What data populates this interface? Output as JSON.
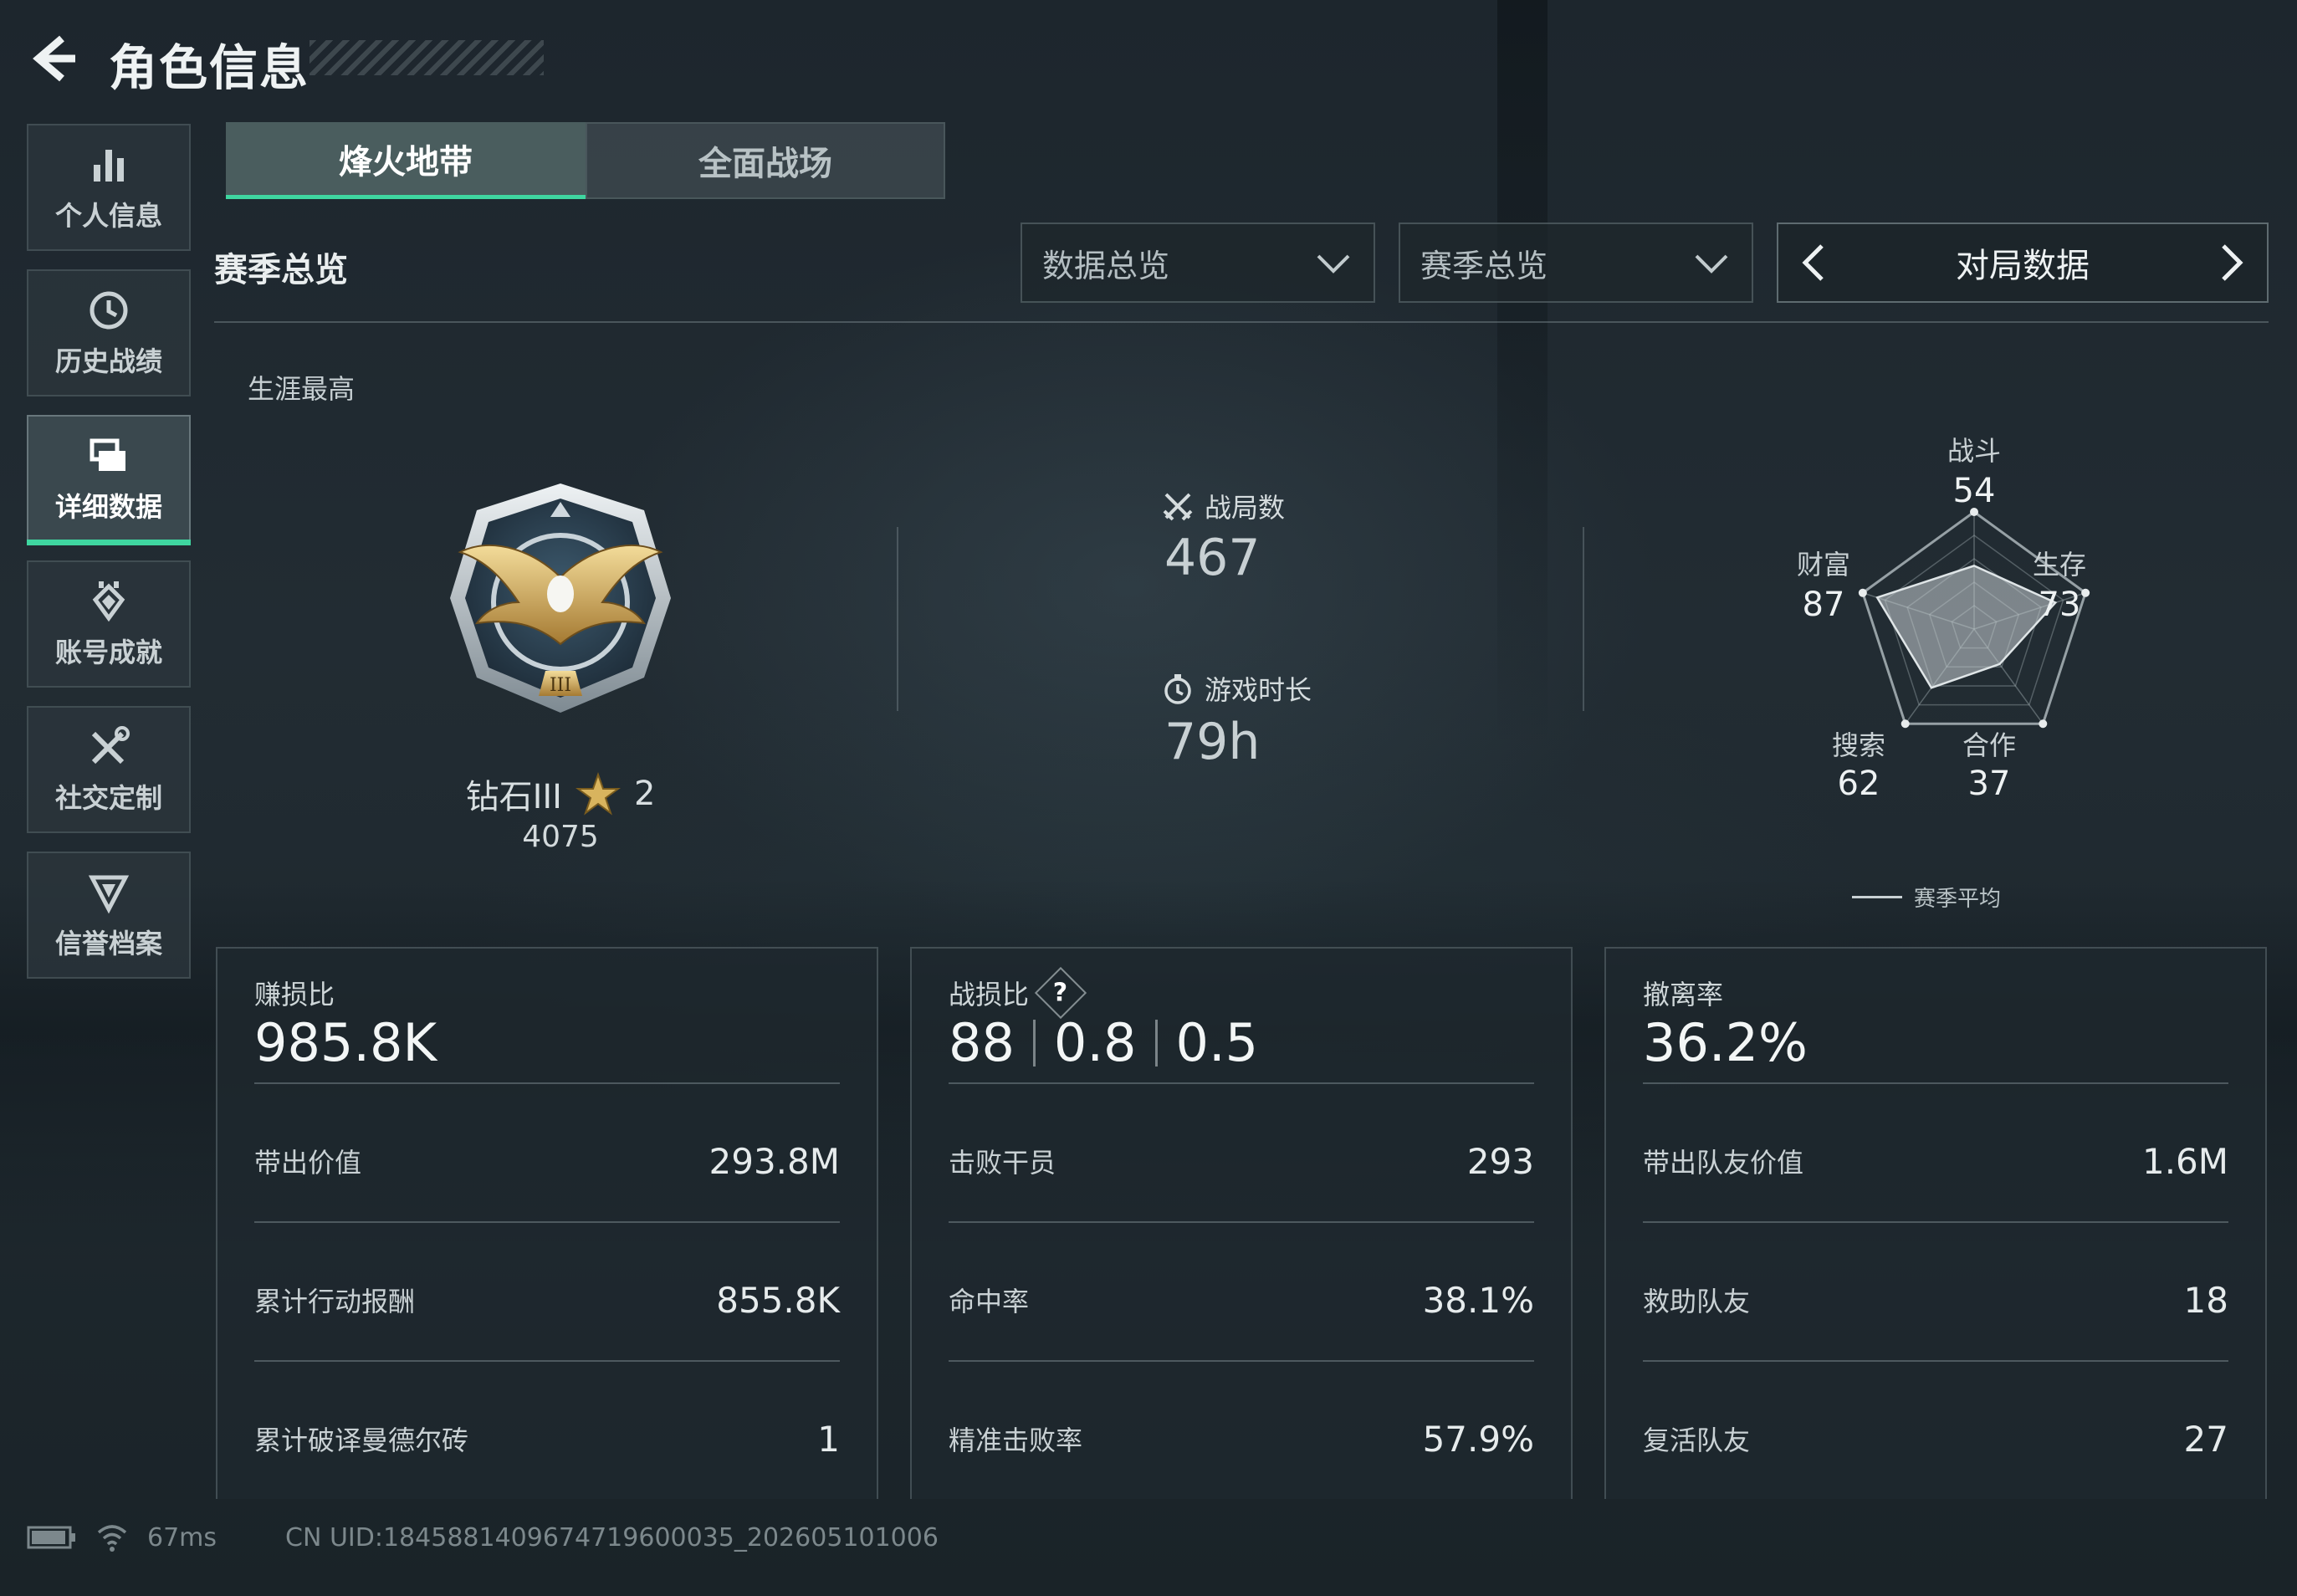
{
  "header": {
    "title": "角色信息"
  },
  "sidebar": {
    "items": [
      {
        "label": "个人信息",
        "icon": "bar-chart-icon"
      },
      {
        "label": "历史战绩",
        "icon": "history-clock-icon"
      },
      {
        "label": "详细数据",
        "icon": "detail-data-icon",
        "active": true
      },
      {
        "label": "账号成就",
        "icon": "achievement-icon"
      },
      {
        "label": "社交定制",
        "icon": "tools-icon"
      },
      {
        "label": "信誉档案",
        "icon": "credit-shield-icon"
      }
    ]
  },
  "tabs": [
    {
      "label": "烽火地带",
      "active": true
    },
    {
      "label": "全面战场",
      "active": false
    }
  ],
  "section": {
    "title": "赛季总览",
    "dropdown_data": "数据总览",
    "dropdown_season": "赛季总览",
    "pager_label": "对局数据"
  },
  "overview": {
    "career_label": "生涯最高",
    "rank_name": "钻石III",
    "rank_stars": "2",
    "rank_score": "4075",
    "matches_label": "战局数",
    "matches_value": "467",
    "playtime_label": "游戏时长",
    "playtime_value": "79h"
  },
  "radar": {
    "axes": [
      {
        "label": "战斗",
        "value": "54"
      },
      {
        "label": "生存",
        "value": "73"
      },
      {
        "label": "合作",
        "value": "37"
      },
      {
        "label": "搜索",
        "value": "62"
      },
      {
        "label": "财富",
        "value": "87"
      }
    ],
    "legend": "赛季平均"
  },
  "panels": {
    "profit": {
      "label": "赚损比",
      "value": "985.8K",
      "rows": [
        {
          "key": "带出价值",
          "value": "293.8M"
        },
        {
          "key": "累计行动报酬",
          "value": "855.8K"
        },
        {
          "key": "累计破译曼德尔砖",
          "value": "1"
        }
      ]
    },
    "combat": {
      "label": "战损比",
      "help": "?",
      "values": [
        "88",
        "0.8",
        "0.5"
      ],
      "rows": [
        {
          "key": "击败干员",
          "value": "293"
        },
        {
          "key": "命中率",
          "value": "38.1%"
        },
        {
          "key": "精准击败率",
          "value": "57.9%"
        }
      ]
    },
    "extract": {
      "label": "撤离率",
      "value": "36.2%",
      "rows": [
        {
          "key": "带出队友价值",
          "value": "1.6M"
        },
        {
          "key": "救助队友",
          "value": "18"
        },
        {
          "key": "复活队友",
          "value": "27"
        }
      ]
    }
  },
  "footer": {
    "ping": "67ms",
    "uid": "CN UID:1845881409674719600035_202605101006"
  },
  "colors": {
    "accent": "#3fd6a0",
    "background": "#1c252c",
    "panel": "#1e282e"
  }
}
